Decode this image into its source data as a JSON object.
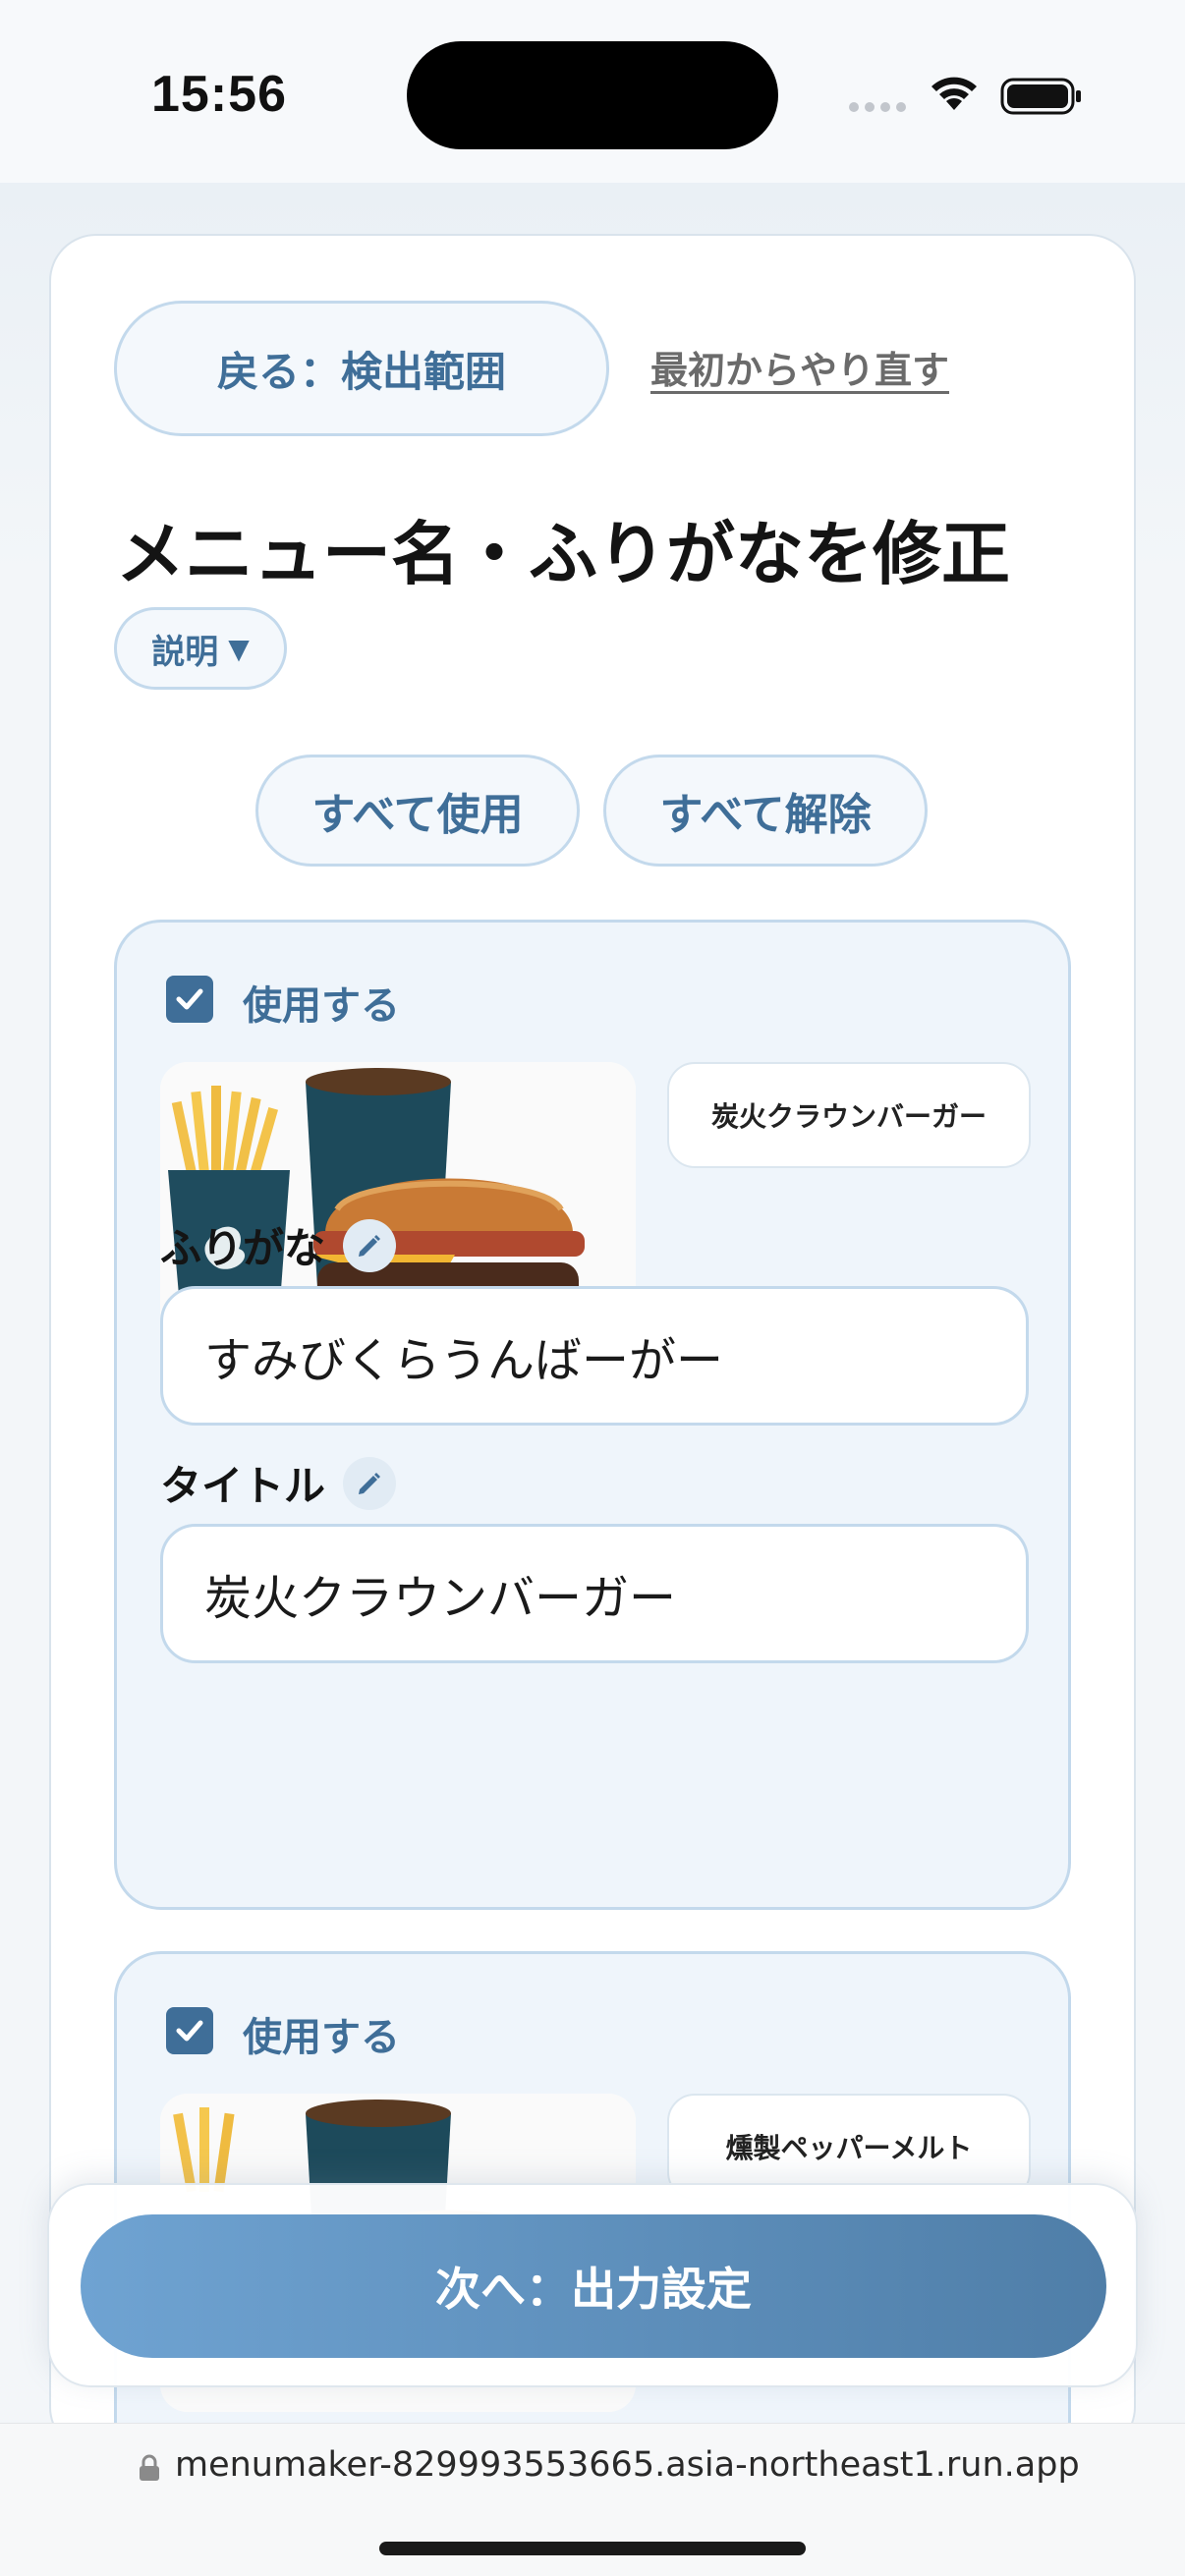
{
  "status_bar": {
    "time": "15:56"
  },
  "header": {
    "back_button": "戻る：検出範囲",
    "restart_link": "最初からやり直す",
    "title": "メニュー名・ふりがなを修正",
    "explain_button": "説明",
    "explain_arrow": "▼"
  },
  "bulk_actions": {
    "use_all": "すべて使用",
    "clear_all": "すべて解除"
  },
  "items": [
    {
      "use_label": "使用する",
      "checked": true,
      "ocr_name": "炭火クラウンバーガー",
      "furigana_label": "ふりがな",
      "furigana_value": "すみびくらうんばーがー",
      "title_label": "タイトル",
      "title_value": "炭火クラウンバーガー"
    },
    {
      "use_label": "使用する",
      "checked": true,
      "ocr_name": "燻製ペッパーメルト"
    }
  ],
  "footer": {
    "next_button": "次へ：出力設定"
  },
  "browser": {
    "url": "menumaker-829993553665.asia-northeast1.run.app"
  },
  "colors": {
    "accent": "#3f6e98",
    "panel": "#eff5fb",
    "border": "#c3d9ec",
    "next_gradient_start": "#6fa3d2",
    "next_gradient_end": "#4f7ea8"
  }
}
